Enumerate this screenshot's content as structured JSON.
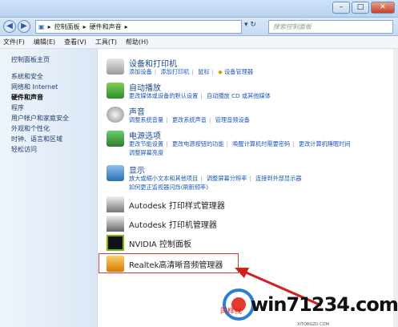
{
  "addressbar": {
    "crumbs": [
      "控制面板",
      "硬件和声音"
    ],
    "search_placeholder": "搜索控制面板"
  },
  "menu": [
    "文件(F)",
    "编辑(E)",
    "查看(V)",
    "工具(T)",
    "帮助(H)"
  ],
  "sidebar": {
    "home": "控制面板主页",
    "items": [
      "系统和安全",
      "网络和 Internet",
      "硬件和声音",
      "程序",
      "用户帐户和家庭安全",
      "外观和个性化",
      "时钟、语言和区域",
      "轻松访问"
    ],
    "current_index": 2
  },
  "categories": [
    {
      "title": "设备和打印机",
      "links": [
        "添加设备",
        "添加打印机",
        "鼠标",
        "设备管理器"
      ]
    },
    {
      "title": "自动播放",
      "links": [
        "更改媒体或设备的默认设置",
        "自动播放 CD 或其他媒体"
      ]
    },
    {
      "title": "声音",
      "links": [
        "调整系统音量",
        "更改系统声音",
        "管理音频设备"
      ]
    },
    {
      "title": "电源选项",
      "links": [
        "更改节能设置",
        "更改电源按钮的功能",
        "唤醒计算机时需要密码",
        "更改计算机睡眠时间"
      ],
      "links2": [
        "调整屏幕亮度"
      ]
    },
    {
      "title": "显示",
      "links": [
        "放大或缩小文本和其他项目",
        "调整屏幕分辨率",
        "连接到外部显示器"
      ],
      "links2": [
        "如何更正监视器闪烁(刷新频率)"
      ]
    }
  ],
  "apps": [
    "Autodesk 打印样式管理器",
    "Autodesk 打印机管理器",
    "NVIDIA 控制面板",
    "Realtek高清晰音频管理器"
  ],
  "watermark": {
    "url": "win71234.com",
    "sub": "同样找",
    "small": "XITONGZU.COM"
  },
  "colors": {
    "highlight_box": "#c94040",
    "arrow": "#d02020",
    "link": "#1f58b5"
  }
}
